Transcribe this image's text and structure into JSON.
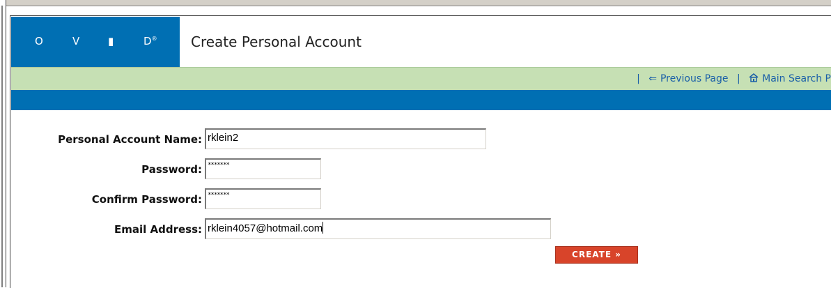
{
  "header": {
    "logo_letters": [
      "O",
      "V",
      "I",
      "D"
    ],
    "logo_reg": "®",
    "title": "Create Personal Account"
  },
  "nav": {
    "separator": "|",
    "previous_icon": "⇐",
    "previous_label": "Previous Page",
    "main_search_icon": "🏠",
    "main_search_label": "Main Search P"
  },
  "form": {
    "account_name_label": "Personal Account Name:",
    "account_name_value": "rklein2",
    "password_label": "Password:",
    "password_value": "*******",
    "confirm_password_label": "Confirm Password:",
    "confirm_password_value": "*******",
    "email_label": "Email Address:",
    "email_value": "rklein4057@hotmail.com",
    "create_label": "CREATE »"
  },
  "colors": {
    "brand_blue": "#006fb3",
    "nav_green": "#c6e0b4",
    "create_red": "#d8442a"
  }
}
